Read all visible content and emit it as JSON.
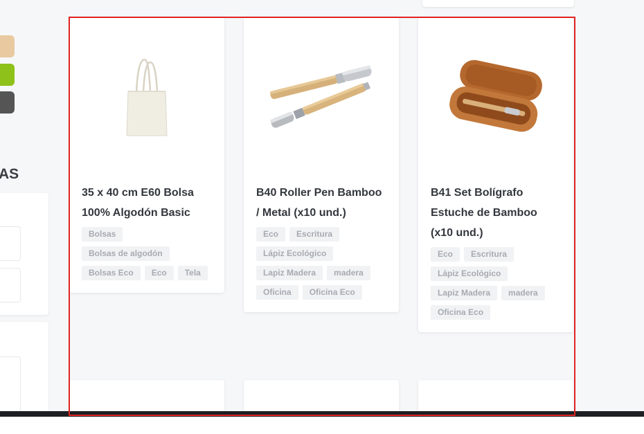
{
  "colors": {
    "swatch_cork": "#e8c9a0",
    "swatch_green": "#8ec11a",
    "swatch_dark": "#555555",
    "highlight": "#e02424"
  },
  "sidebar": {
    "heading": "AS"
  },
  "products": [
    {
      "title": "35 x 40 cm E60 Bolsa 100% Algodón Basic",
      "image": "tote-bag-icon",
      "tags": [
        "Bolsas",
        "Bolsas de algodón",
        "Bolsas Eco",
        "Eco",
        "Tela"
      ]
    },
    {
      "title": "B40 Roller Pen Bamboo / Metal (x10 und.)",
      "image": "bamboo-pens-icon",
      "tags": [
        "Eco",
        "Escritura",
        "Lápiz Ecológico",
        "Lapiz Madera",
        "madera",
        "Oficina",
        "Oficina Eco"
      ]
    },
    {
      "title": "B41 Set Bolígrafo Estuche de Bamboo (x10 und.)",
      "image": "pen-case-icon",
      "tags": [
        "Eco",
        "Escritura",
        "Lápiz Ecológico",
        "Lapiz Madera",
        "madera",
        "Oficina Eco"
      ]
    }
  ]
}
